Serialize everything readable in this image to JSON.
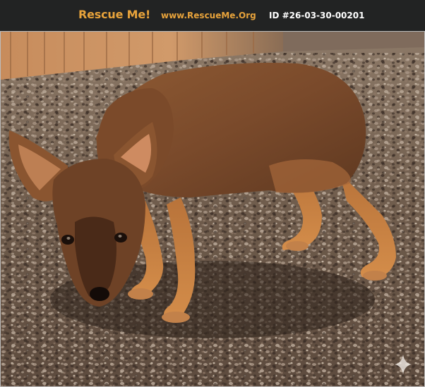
{
  "header": {
    "logo_text": "Rescue Me!",
    "site_url": "www.RescueMe.Org",
    "pet_id": "ID #26-03-30-00201"
  },
  "photo": {
    "subject": "brown puppy standing on gravel",
    "icons": [
      "sparkle-icon"
    ]
  },
  "colors": {
    "header_bg": "#222323",
    "brand_orange": "#e8a33b",
    "id_text": "#ffffff"
  }
}
